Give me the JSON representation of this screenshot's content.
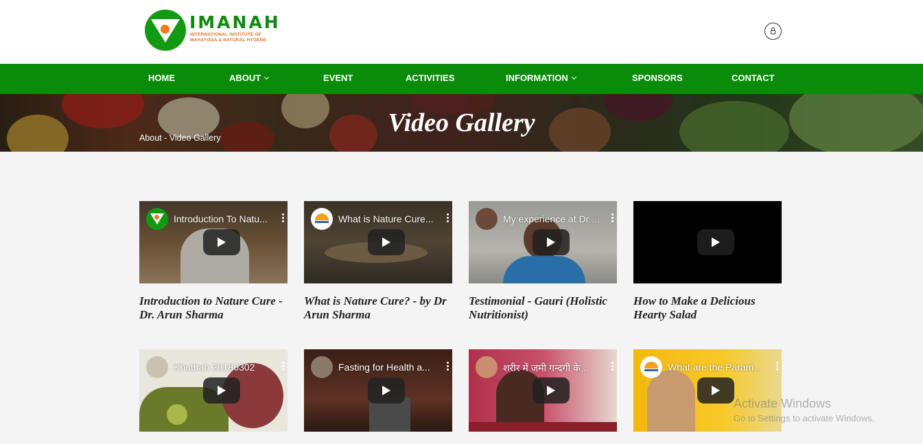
{
  "logo": {
    "title": "IMANAH",
    "subtitle_line1": "INTERNATIONAL INSTITUTE OF",
    "subtitle_line2": "MAHAYOGA & NATURAL HYGENE"
  },
  "nav": {
    "home": "HOME",
    "about": "ABOUT",
    "event": "EVENT",
    "activities": "ACTIVITIES",
    "information": "INFORMATION",
    "sponsors": "SPONSORS",
    "contact": "CONTACT"
  },
  "banner": {
    "title": "Video Gallery",
    "breadcrumb": "About - Video Gallery"
  },
  "videos": [
    {
      "overlay": "Introduction To Natu...",
      "caption": "Introduction to Nature Cure - Dr. Arun Sharma"
    },
    {
      "overlay": "What is Nature Cure...",
      "caption": "What is Nature Cure? - by Dr Arun Sharma"
    },
    {
      "overlay": "My experience at Dr ...",
      "caption": "Testimonial - Gauri (Holistic Nutritionist)"
    },
    {
      "overlay": "",
      "caption": "How to Make a Delicious Hearty Salad"
    },
    {
      "overlay": "Khutbah 20180302",
      "caption": ""
    },
    {
      "overlay": "Fasting for Health a...",
      "caption": ""
    },
    {
      "overlay": "शरीर में जमी गन्दगी के...",
      "caption": ""
    },
    {
      "overlay": "What are the Param...",
      "caption": ""
    }
  ],
  "watermark": {
    "line1": "Activate Windows",
    "line2": "Go to Settings to activate Windows."
  },
  "colors": {
    "nav_green": "#0a8c0a",
    "logo_green": "#139a13",
    "logo_orange": "#f07a1a"
  }
}
